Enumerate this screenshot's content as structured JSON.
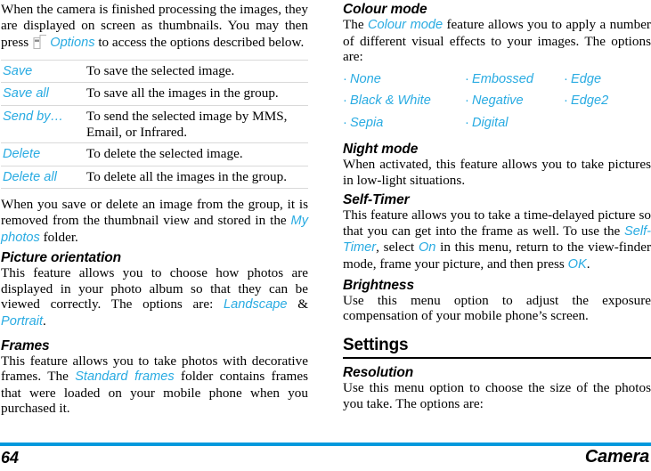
{
  "page": {
    "number": "64",
    "chapter": "Camera",
    "accent_color": "#29ABE2",
    "footer_rule_color": "#0099DD"
  },
  "left_column": {
    "intro": {
      "part1": "When the camera is finished processing the images, they are displayed on screen as thumbnails. You may then press",
      "softkey_icon": "left-softkey-icon",
      "link": "Options",
      "part2": "to access the options described below."
    },
    "options_table": {
      "rows": [
        {
          "term": "Save",
          "desc": "To save the selected image."
        },
        {
          "term": "Save all",
          "desc": "To save all the images in the group."
        },
        {
          "term": "Send by…",
          "desc": "To send the selected image by MMS, Email, or Infrared."
        },
        {
          "term": "Delete",
          "desc": "To delete the selected image."
        },
        {
          "term": "Delete all",
          "desc": "To delete all the images in the group."
        }
      ]
    },
    "after_table": {
      "part1": "When you save or delete an image from the group, it is removed from the thumbnail view and stored in the",
      "link": "My photos",
      "part2": "folder."
    },
    "picture_orientation": {
      "heading": "Picture orientation",
      "part1": "This feature allows you to choose how photos are displayed in your photo album so that they can be viewed correctly. The options are:",
      "link1": "Landscape",
      "amp": "&",
      "link2": "Portrait",
      "part2": "."
    },
    "frames": {
      "heading": "Frames",
      "part1": "This feature allows you to take photos with decorative frames. The",
      "link": "Standard frames",
      "part2": "folder contains frames that were loaded on your mobile phone when you purchased it."
    }
  },
  "right_column": {
    "colour_mode": {
      "heading": "Colour mode",
      "part1": "The",
      "link": "Colour mode",
      "part2": "feature allows you to apply a number of different visual effects to your images. The options are:",
      "options_columns": [
        [
          "None",
          "Black & White",
          "Sepia"
        ],
        [
          "Embossed",
          "Negative",
          "Digital"
        ],
        [
          "Edge",
          "Edge2"
        ]
      ]
    },
    "night_mode": {
      "heading": "Night mode",
      "text": "When activated, this feature allows you to take pictures in low-light situations."
    },
    "self_timer": {
      "heading": "Self-Timer",
      "part1": "This feature allows you to take a time-delayed picture so that you can get into the frame as well. To use the",
      "link1": "Self-Timer",
      "part2": ", select",
      "link2": "On",
      "part3": "in this menu, return to the view-finder mode, frame your picture, and then press",
      "link3": "OK",
      "part4": "."
    },
    "brightness": {
      "heading": "Brightness",
      "text": "Use this menu option to adjust the exposure compensation of your mobile phone’s screen."
    },
    "settings": {
      "heading": "Settings",
      "resolution": {
        "heading": "Resolution",
        "text": "Use this menu option to choose the size of the photos you take. The options are:"
      }
    }
  }
}
